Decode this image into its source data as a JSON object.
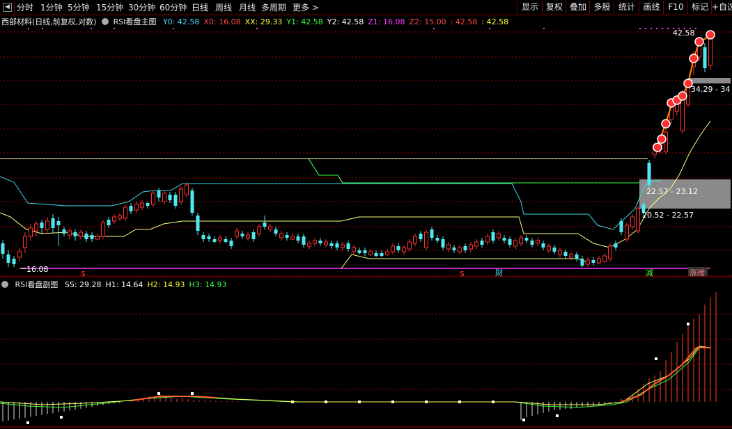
{
  "toolbar": {
    "tabs": [
      "分时",
      "1分钟",
      "5分钟",
      "15分钟",
      "30分钟",
      "60分钟",
      "日线",
      "周线",
      "月线",
      "多周期",
      "更多"
    ],
    "active_tab": "日线",
    "more_arrow": ">",
    "right_buttons": [
      "显示",
      "复权",
      "叠加",
      "多股",
      "统计",
      "画线",
      "F10",
      "标记",
      "+自选"
    ]
  },
  "main_panel": {
    "stock_title": "西部材料(日线,前复权,对数)",
    "indicator_name": "RSI看盘主图",
    "values": [
      {
        "label": "Y0: 42.58",
        "color": "#4fd8ff"
      },
      {
        "label": "X0: 16.08",
        "color": "#ff4a4a"
      },
      {
        "label": "XX: 29.33",
        "color": "#ffff40"
      },
      {
        "label": "Y1: 42.58",
        "color": "#40ff40"
      },
      {
        "label": "Y2: 42.58",
        "color": "#ffffff"
      },
      {
        "label": "Z1: 16.08",
        "color": "#ff40ff"
      },
      {
        "label": "Z2: 15.00",
        "color": "#ff4a4a"
      },
      {
        "label": ": 42.58",
        "color": "#ff4a4a"
      },
      {
        "label": ": 42.58",
        "color": "#ffff40"
      }
    ],
    "price_labels": {
      "high": "42.58",
      "low": "16.08",
      "band_top": "34.29 - 34",
      "band_mid": "22.57 - 23.12",
      "band_low": "20.52 - 22.57"
    },
    "markers": {
      "s1": "$",
      "s2": "$",
      "cai": "财",
      "jian": "减",
      "zhangbang": "涨榜"
    }
  },
  "sub_panel": {
    "indicator_name": "RSI看盘副图",
    "values": [
      {
        "label": "SS: 29.28",
        "color": "#ffffff"
      },
      {
        "label": "H1: 14.64",
        "color": "#ffffff"
      },
      {
        "label": "H2: 14.93",
        "color": "#ffff40"
      },
      {
        "label": "H3: 14.93",
        "color": "#40ff40"
      }
    ]
  },
  "colors": {
    "up": "#ff3030",
    "down": "#4fe8f0",
    "cyan_line": "#40d8e8",
    "yellow_line": "#ffff80",
    "green_line": "#40ff40",
    "magenta_line": "#c030c0",
    "grid": "#a00000"
  }
}
